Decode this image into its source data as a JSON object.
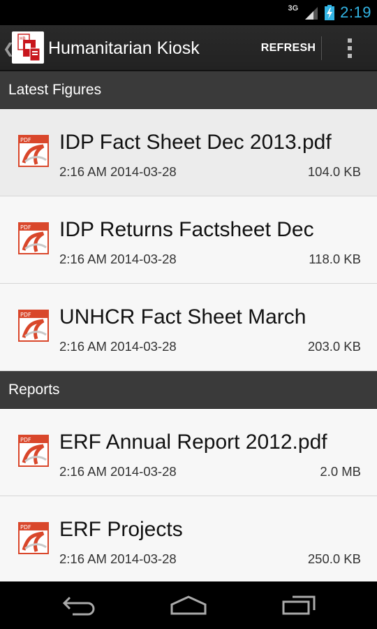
{
  "status_bar": {
    "network": "3G",
    "time": "2:19"
  },
  "action_bar": {
    "title": "Humanitarian Kiosk",
    "refresh_label": "REFRESH",
    "icons": [
      "up-chevron-icon",
      "app-logo-icon",
      "overflow-menu-icon"
    ]
  },
  "sections": [
    {
      "header": "Latest Figures",
      "items": [
        {
          "title": "IDP Fact Sheet Dec 2013.pdf",
          "date": "2:16 AM 2014-03-28",
          "size": "104.0 KB",
          "icon": "pdf-icon"
        },
        {
          "title": "IDP Returns Factsheet Dec",
          "date": "2:16 AM 2014-03-28",
          "size": "118.0 KB",
          "icon": "pdf-icon"
        },
        {
          "title": "UNHCR Fact Sheet March",
          "date": "2:16 AM 2014-03-28",
          "size": "203.0 KB",
          "icon": "pdf-icon"
        }
      ]
    },
    {
      "header": "Reports",
      "items": [
        {
          "title": "ERF Annual Report 2012.pdf",
          "date": "2:16 AM 2014-03-28",
          "size": "2.0 MB",
          "icon": "pdf-icon"
        },
        {
          "title": "ERF Projects",
          "date": "2:16 AM 2014-03-28",
          "size": "250.0 KB",
          "icon": "pdf-icon"
        }
      ]
    }
  ],
  "pdf_icon_label": "PDF",
  "nav_bar": [
    "back-icon",
    "home-icon",
    "recent-apps-icon"
  ],
  "colors": {
    "clock": "#33b5e5",
    "pdf_red": "#d9472b",
    "section_header_bg": "#3a3a3a"
  }
}
